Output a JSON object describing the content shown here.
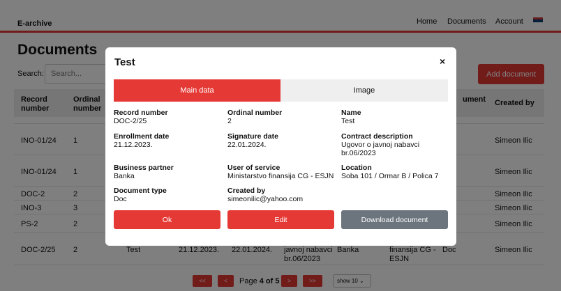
{
  "navbar": {
    "brand": "E-archive",
    "links": [
      "Home",
      "Documents",
      "Account"
    ],
    "flag_colors": [
      "#c6363c",
      "#0c4076",
      "#ffffff"
    ]
  },
  "page": {
    "title": "Documents",
    "search_label": "Search:",
    "search_placeholder": "Search...",
    "add_button": "Add document"
  },
  "table": {
    "headers": [
      "Record number",
      "Ordinal number",
      "ument",
      "Created by"
    ],
    "rows": [
      {
        "record": "INO-01/24",
        "ordinal": "1",
        "created_by": "Simeon Ilic"
      },
      {
        "record": "INO-01/24",
        "ordinal": "1",
        "created_by": "Simeon Ilic"
      },
      {
        "record": "DOC-2",
        "ordinal": "2",
        "created_by": "Simeon Ilic"
      },
      {
        "record": "INO-3",
        "ordinal": "3",
        "created_by": "Simeon Ilic"
      },
      {
        "record": "PS-2",
        "ordinal": "2",
        "created_by": "Simeon Ilic"
      },
      {
        "record": "DOC-2/25",
        "ordinal": "2",
        "name": "Test",
        "enrollment": "21.12.2023.",
        "signature": "22.01.2024.",
        "description": [
          "javnoj nabavci",
          "br.06/2023"
        ],
        "partner": "Banka",
        "user": [
          "finansija CG -",
          "ESJN"
        ],
        "type": "Doc",
        "created_by": "Simeon Ilic"
      }
    ]
  },
  "pagination": {
    "first": "<<",
    "prev": "<",
    "page_prefix": "Page ",
    "current": "4",
    "of_text": " of ",
    "total": "5",
    "next": ">",
    "last": ">>",
    "show": "show 10"
  },
  "modal": {
    "title": "Test",
    "close": "×",
    "tabs": [
      "Main data",
      "Image"
    ],
    "fields": {
      "record_number": {
        "label": "Record number",
        "value": "DOC-2/25"
      },
      "ordinal_number": {
        "label": "Ordinal number",
        "value": "2"
      },
      "name": {
        "label": "Name",
        "value": "Test"
      },
      "enrollment_date": {
        "label": "Enrollment date",
        "value": "21.12.2023."
      },
      "signature_date": {
        "label": "Signature date",
        "value": "22.01.2024."
      },
      "contract_description": {
        "label": "Contract description",
        "value1": "Ugovor o javnoj nabavci",
        "value2": "br.06/2023"
      },
      "business_partner": {
        "label": "Business partner",
        "value": "Banka"
      },
      "user_of_service": {
        "label": "User of service",
        "value": "Ministarstvo finansija CG - ESJN"
      },
      "location": {
        "label": "Location",
        "value": "Soba 101 / Ormar B / Polica 7"
      },
      "document_type": {
        "label": "Document type",
        "value": "Doc"
      },
      "created_by": {
        "label": "Created by",
        "value": "simeonilic@yahoo.com"
      }
    },
    "buttons": {
      "ok": "Ok",
      "edit": "Edit",
      "download": "Download document"
    }
  }
}
